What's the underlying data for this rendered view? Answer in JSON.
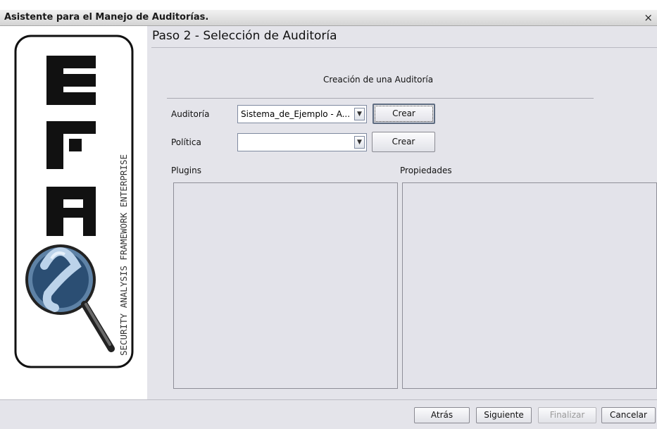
{
  "window": {
    "title": "Asistente para el Manejo de Auditorías.",
    "close_glyph": "×"
  },
  "logo": {
    "letters": "SAFE",
    "tagline": "SECURITY ANALYSIS FRAMEWORK ENTERPRISE"
  },
  "step": {
    "title": "Paso 2 - Selección de Auditoría"
  },
  "section": {
    "title": "Creación de una Auditoría"
  },
  "form": {
    "audit_label": "Auditoría",
    "audit_value": "Sistema_de_Ejemplo - A...",
    "audit_create": "Crear",
    "policy_label": "Política",
    "policy_value": "",
    "policy_create": "Crear"
  },
  "panels": {
    "plugins_label": "Plugins",
    "properties_label": "Propiedades"
  },
  "nav": {
    "back": "Atrás",
    "next": "Siguiente",
    "finish": "Finalizar",
    "cancel": "Cancelar"
  }
}
